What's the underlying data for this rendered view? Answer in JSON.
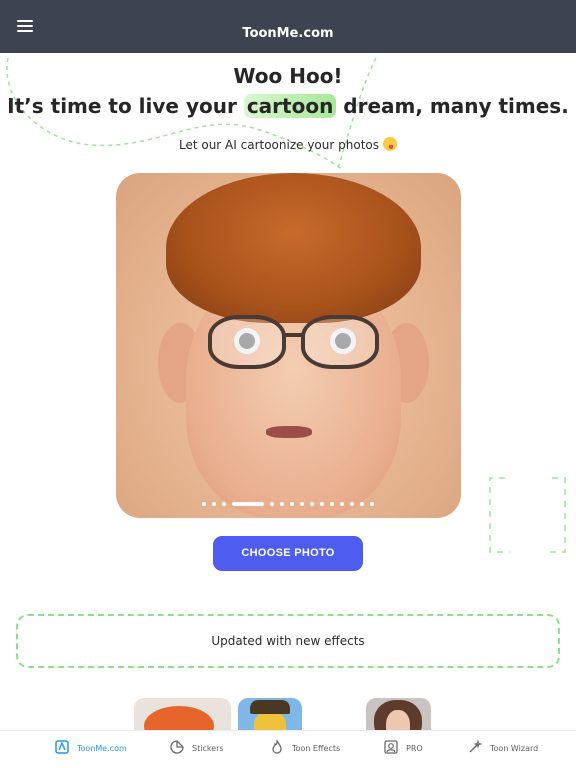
{
  "topbar": {
    "brand": "ToonMe.com",
    "menu_icon": "hamburger-menu-icon"
  },
  "hero": {
    "title_line1": "Woo Hoo!",
    "title_line2_pre": "It’s time to live your ",
    "title_line2_highlight": "cartoon",
    "title_line2_post": " dream, many times.",
    "subtitle": "Let our AI cartoonize your photos",
    "subtitle_emoji": "winking-tongue-emoji"
  },
  "carousel": {
    "slide_count": 15,
    "active_index": 3
  },
  "cta": {
    "label": "CHOOSE PHOTO"
  },
  "updates": {
    "text": "Updated with new effects"
  },
  "bottom_nav": {
    "items": [
      {
        "label": "ToonMe.com",
        "icon": "toonme-logo-icon",
        "active": true
      },
      {
        "label": "Stickers",
        "icon": "sticker-icon",
        "active": false
      },
      {
        "label": "Toon Effects",
        "icon": "flame-icon",
        "active": false
      },
      {
        "label": "PRO",
        "icon": "pro-portrait-icon",
        "active": false
      },
      {
        "label": "Toon Wizard",
        "icon": "magic-wand-icon",
        "active": false
      }
    ]
  },
  "colors": {
    "topbar": "#3d4350",
    "cta": "#4f5cf0",
    "highlight": "#a7e89a",
    "dashed_border": "#8fe08a",
    "nav_active": "#1f9be7"
  }
}
